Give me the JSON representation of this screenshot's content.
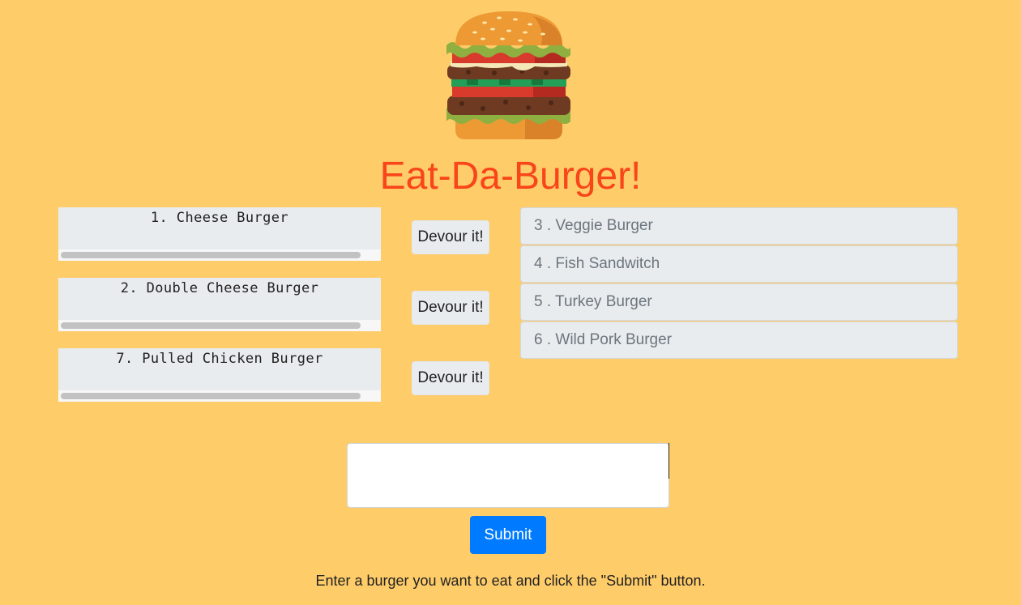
{
  "header": {
    "title": "Eat-Da-Burger!",
    "logo_icon": "burger-icon"
  },
  "not_devoured": [
    {
      "label": "1. Cheese Burger",
      "button": "Devour it!"
    },
    {
      "label": "2. Double Cheese Burger",
      "button": "Devour it!"
    },
    {
      "label": "7. Pulled Chicken Burger",
      "button": "Devour it!"
    }
  ],
  "devoured": [
    {
      "label": "3 . Veggie Burger"
    },
    {
      "label": "4 . Fish Sandwitch"
    },
    {
      "label": "5 . Turkey Burger"
    },
    {
      "label": "6 . Wild Pork Burger"
    }
  ],
  "form": {
    "input_value": "",
    "submit_label": "Submit",
    "instructions": "Enter a burger you want to eat and click the \"Submit\" button."
  },
  "colors": {
    "background": "#FFCC6A",
    "title": "#F8461A",
    "submit_button": "#007BFF",
    "list_item": "#E9ECEF"
  }
}
